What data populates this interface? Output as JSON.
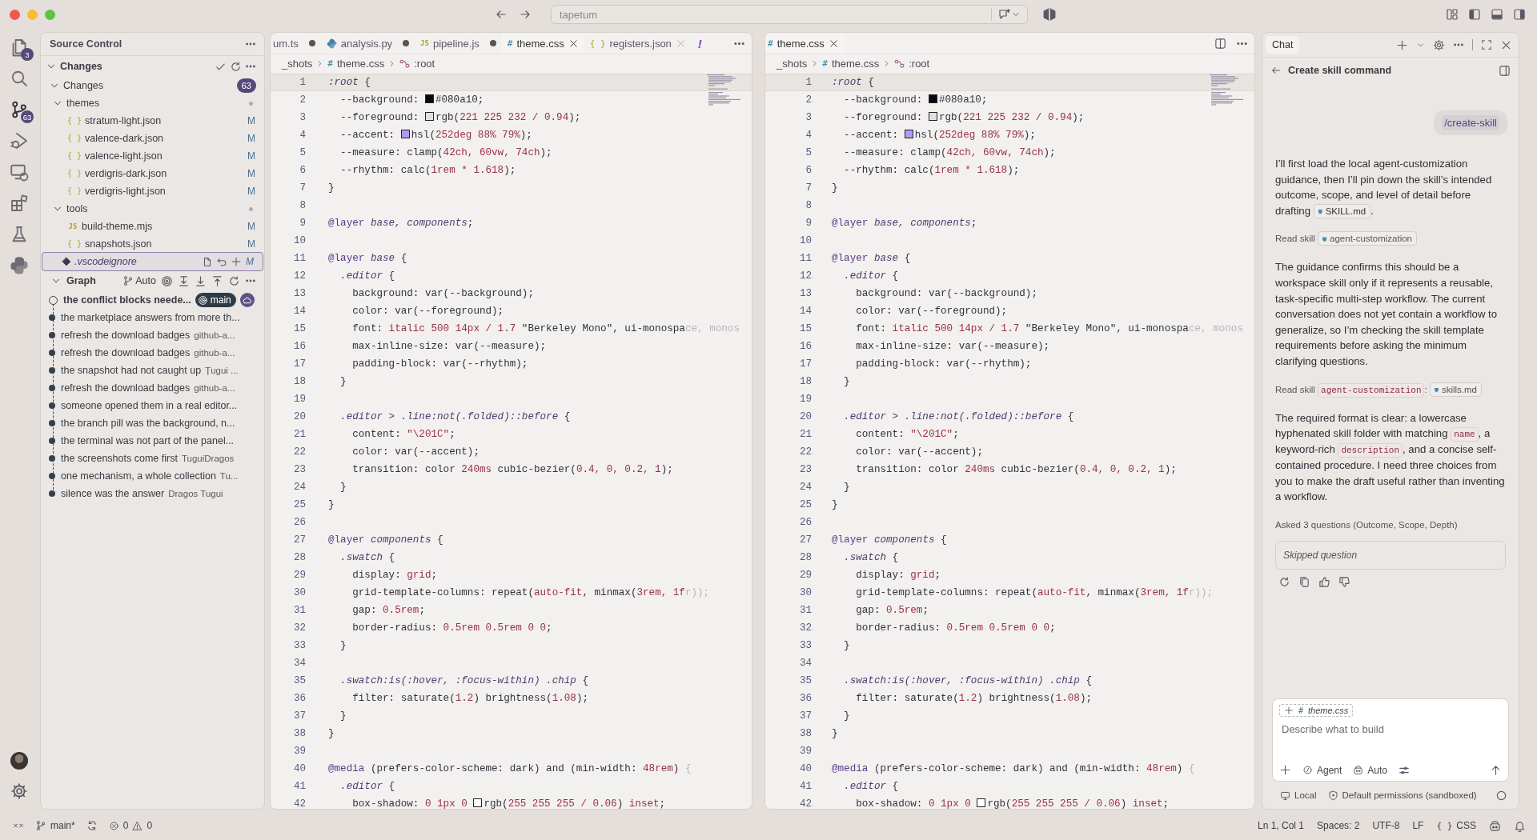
{
  "title_bar": {
    "title": "tapetum"
  },
  "activity_bar": {
    "items": [
      {
        "kind": "files",
        "badge": "3",
        "selected": false
      },
      {
        "kind": "search",
        "selected": false
      },
      {
        "kind": "scm",
        "badge": "63",
        "selected": true
      },
      {
        "kind": "debug",
        "selected": false
      },
      {
        "kind": "remote",
        "selected": false
      },
      {
        "kind": "extensions",
        "selected": false
      },
      {
        "kind": "testing",
        "selected": false
      },
      {
        "kind": "python",
        "selected": false
      }
    ],
    "bottom": [
      {
        "kind": "account"
      },
      {
        "kind": "settings"
      }
    ]
  },
  "sidebar": {
    "title": "Source Control",
    "changes": {
      "title": "Changes",
      "expanded": true,
      "group": {
        "label": "Changes",
        "count": "63",
        "expanded": true,
        "children": [
          {
            "kind": "folder",
            "label": "themes",
            "expanded": true,
            "selected": false,
            "children": [
              {
                "kind": "file",
                "icon": "{ }",
                "label": "stratum-light.json",
                "status": "M",
                "selected": false
              },
              {
                "kind": "file",
                "icon": "{ }",
                "label": "valence-dark.json",
                "status": "M",
                "selected": false
              },
              {
                "kind": "file",
                "icon": "{ }",
                "label": "valence-light.json",
                "status": "M",
                "selected": false
              },
              {
                "kind": "file",
                "icon": "{ }",
                "label": "verdigris-dark.json",
                "status": "M",
                "selected": false
              },
              {
                "kind": "file",
                "icon": "{ }",
                "label": "verdigris-light.json",
                "status": "M",
                "selected": false
              }
            ]
          },
          {
            "kind": "folder",
            "label": "tools",
            "expanded": true,
            "selected": false,
            "children": [
              {
                "kind": "file",
                "icon": "JS",
                "label": "build-theme.mjs",
                "status": "M",
                "selected": false
              },
              {
                "kind": "file",
                "icon": "{ }",
                "label": "snapshots.json",
                "status": "M",
                "selected": false
              }
            ]
          },
          {
            "kind": "ignore",
            "label": ".vscodeignore",
            "status": "M",
            "selected": true
          }
        ]
      }
    },
    "graph": {
      "title": "Graph",
      "filter": "Auto",
      "expanded": true,
      "commits": [
        {
          "message": "the conflict blocks neede...",
          "branch": "main",
          "head": true
        },
        {
          "message": "the marketplace answers from more th...",
          "head": false
        },
        {
          "message": "refresh the download badges",
          "author": "github-a...",
          "head": false
        },
        {
          "message": "refresh the download badges",
          "author": "github-a...",
          "head": false
        },
        {
          "message": "the snapshot had not caught up",
          "author": "Țugui ...",
          "head": false
        },
        {
          "message": "refresh the download badges",
          "author": "github-a...",
          "head": false
        },
        {
          "message": "someone opened them in a real editor...",
          "head": false
        },
        {
          "message": "the branch pill was the background, n...",
          "head": false
        },
        {
          "message": "the terminal was not part of the panel...",
          "head": false
        },
        {
          "message": "the screenshots come first",
          "author": "TuguiDragos",
          "head": false
        },
        {
          "message": "one mechanism, a whole collection",
          "author": "Tu...",
          "head": false
        },
        {
          "message": "silence was the answer",
          "author": "Dragos Tugui",
          "head": false
        }
      ]
    }
  },
  "editors": [
    {
      "tabs": [
        {
          "label": "um.ts",
          "kind": "none",
          "dirty": true,
          "selected": false
        },
        {
          "label": "analysis.py",
          "kind": "python",
          "dirty": true,
          "selected": false
        },
        {
          "label": "pipeline.js",
          "kind": "text",
          "icon": "JS",
          "dirty": true,
          "selected": false
        },
        {
          "label": "theme.css",
          "kind": "text",
          "icon": "#",
          "dirty": false,
          "selected": true
        },
        {
          "label": "registers.json",
          "kind": "text",
          "icon": "{ }",
          "dirty": false,
          "selected": false
        }
      ],
      "notice": "!",
      "breadcrumbs": [
        {
          "kind": "folder",
          "label": "_shots"
        },
        {
          "kind": "file",
          "icon": "#",
          "label": "theme.css"
        },
        {
          "kind": "symbol",
          "label": ":root"
        }
      ],
      "lines": [
        {
          "number": "1",
          "current": true,
          "tokens": [
            {
              "kind": "sel",
              "text": ":root"
            },
            {
              "kind": "plain",
              "text": " {"
            }
          ]
        },
        {
          "number": "2",
          "current": false,
          "tokens": [
            {
              "kind": "plain",
              "text": "  --background: "
            },
            {
              "kind": "swatch",
              "color": "#080a10"
            },
            {
              "kind": "plain",
              "text": "#080a10;"
            }
          ]
        },
        {
          "number": "3",
          "current": false,
          "tokens": [
            {
              "kind": "plain",
              "text": "  --foreground: "
            },
            {
              "kind": "swatch",
              "color": "#dde1e8"
            },
            {
              "kind": "plain",
              "text": "rgb("
            },
            {
              "kind": "num",
              "text": "221 225 232 / 0.94"
            },
            {
              "kind": "plain",
              "text": ");"
            }
          ]
        },
        {
          "number": "4",
          "current": false,
          "tokens": [
            {
              "kind": "plain",
              "text": "  --accent: "
            },
            {
              "kind": "swatch",
              "color": "#ad9af9"
            },
            {
              "kind": "plain",
              "text": "hsl("
            },
            {
              "kind": "num",
              "text": "252deg 88% 79%"
            },
            {
              "kind": "plain",
              "text": ");"
            }
          ]
        },
        {
          "number": "5",
          "current": false,
          "tokens": [
            {
              "kind": "plain",
              "text": "  --measure: clamp("
            },
            {
              "kind": "num",
              "text": "42ch, 60vw, 74ch"
            },
            {
              "kind": "plain",
              "text": ");"
            }
          ]
        },
        {
          "number": "6",
          "current": false,
          "tokens": [
            {
              "kind": "plain",
              "text": "  --rhythm: calc("
            },
            {
              "kind": "num",
              "text": "1rem * 1.618"
            },
            {
              "kind": "plain",
              "text": ");"
            }
          ]
        },
        {
          "number": "7",
          "current": false,
          "tokens": [
            {
              "kind": "plain",
              "text": "}"
            }
          ]
        },
        {
          "number": "8",
          "current": false
        },
        {
          "number": "9",
          "current": false,
          "tokens": [
            {
              "kind": "at",
              "text": "@layer"
            },
            {
              "kind": "sel",
              "text": " base, components"
            },
            {
              "kind": "plain",
              "text": ";"
            }
          ]
        },
        {
          "number": "10",
          "current": false
        },
        {
          "number": "11",
          "current": false,
          "tokens": [
            {
              "kind": "at",
              "text": "@layer"
            },
            {
              "kind": "sel",
              "text": " base"
            },
            {
              "kind": "plain",
              "text": " {"
            }
          ]
        },
        {
          "number": "12",
          "current": false,
          "tokens": [
            {
              "kind": "sel",
              "text": "  .editor"
            },
            {
              "kind": "plain",
              "text": " {"
            }
          ]
        },
        {
          "number": "13",
          "current": false,
          "tokens": [
            {
              "kind": "plain",
              "text": "    background: var(--background);"
            }
          ]
        },
        {
          "number": "14",
          "current": false,
          "tokens": [
            {
              "kind": "plain",
              "text": "    color: var(--foreground);"
            }
          ]
        },
        {
          "number": "15",
          "current": false,
          "tokens": [
            {
              "kind": "plain",
              "text": "    font: "
            },
            {
              "kind": "num",
              "text": "italic 500 14px / 1.7"
            },
            {
              "kind": "plain",
              "text": " \"Berkeley Mono\", ui-monospa"
            },
            {
              "kind": "fade",
              "text": "ce, monos"
            }
          ]
        },
        {
          "number": "16",
          "current": false,
          "tokens": [
            {
              "kind": "plain",
              "text": "    max-inline-size: var(--measure);"
            }
          ]
        },
        {
          "number": "17",
          "current": false,
          "tokens": [
            {
              "kind": "plain",
              "text": "    padding-block: var(--rhythm);"
            }
          ]
        },
        {
          "number": "18",
          "current": false,
          "tokens": [
            {
              "kind": "plain",
              "text": "  }"
            }
          ]
        },
        {
          "number": "19",
          "current": false
        },
        {
          "number": "20",
          "current": false,
          "tokens": [
            {
              "kind": "sel",
              "text": "  .editor > .line:not(.folded)::before"
            },
            {
              "kind": "plain",
              "text": " {"
            }
          ]
        },
        {
          "number": "21",
          "current": false,
          "tokens": [
            {
              "kind": "plain",
              "text": "    content: "
            },
            {
              "kind": "num",
              "text": "\"\\201C\""
            },
            {
              "kind": "plain",
              "text": ";"
            }
          ]
        },
        {
          "number": "22",
          "current": false,
          "tokens": [
            {
              "kind": "plain",
              "text": "    color: var(--accent);"
            }
          ]
        },
        {
          "number": "23",
          "current": false,
          "tokens": [
            {
              "kind": "plain",
              "text": "    transition: color "
            },
            {
              "kind": "num",
              "text": "240ms"
            },
            {
              "kind": "plain",
              "text": " cubic-bezier("
            },
            {
              "kind": "num",
              "text": "0.4, 0, 0.2, 1"
            },
            {
              "kind": "plain",
              "text": ");"
            }
          ]
        },
        {
          "number": "24",
          "current": false,
          "tokens": [
            {
              "kind": "plain",
              "text": "  }"
            }
          ]
        },
        {
          "number": "25",
          "current": false,
          "tokens": [
            {
              "kind": "plain",
              "text": "}"
            }
          ]
        },
        {
          "number": "26",
          "current": false
        },
        {
          "number": "27",
          "current": false,
          "tokens": [
            {
              "kind": "at",
              "text": "@layer"
            },
            {
              "kind": "sel",
              "text": " components"
            },
            {
              "kind": "plain",
              "text": " {"
            }
          ]
        },
        {
          "number": "28",
          "current": false,
          "tokens": [
            {
              "kind": "sel",
              "text": "  .swatch"
            },
            {
              "kind": "plain",
              "text": " {"
            }
          ]
        },
        {
          "number": "29",
          "current": false,
          "tokens": [
            {
              "kind": "plain",
              "text": "    display: "
            },
            {
              "kind": "num",
              "text": "grid"
            },
            {
              "kind": "plain",
              "text": ";"
            }
          ]
        },
        {
          "number": "30",
          "current": false,
          "tokens": [
            {
              "kind": "plain",
              "text": "    grid-template-columns: repeat("
            },
            {
              "kind": "num",
              "text": "auto-fit"
            },
            {
              "kind": "plain",
              "text": ", minmax("
            },
            {
              "kind": "num",
              "text": "3rem, 1f"
            },
            {
              "kind": "fade",
              "text": "r));"
            }
          ]
        },
        {
          "number": "31",
          "current": false,
          "tokens": [
            {
              "kind": "plain",
              "text": "    gap: "
            },
            {
              "kind": "num",
              "text": "0.5rem"
            },
            {
              "kind": "plain",
              "text": ";"
            }
          ]
        },
        {
          "number": "32",
          "current": false,
          "tokens": [
            {
              "kind": "plain",
              "text": "    border-radius: "
            },
            {
              "kind": "num",
              "text": "0.5rem 0.5rem 0 0"
            },
            {
              "kind": "plain",
              "text": ";"
            }
          ]
        },
        {
          "number": "33",
          "current": false,
          "tokens": [
            {
              "kind": "plain",
              "text": "  }"
            }
          ]
        },
        {
          "number": "34",
          "current": false
        },
        {
          "number": "35",
          "current": false,
          "tokens": [
            {
              "kind": "sel",
              "text": "  .swatch:is(:hover, :focus-within) .chip"
            },
            {
              "kind": "plain",
              "text": " {"
            }
          ]
        },
        {
          "number": "36",
          "current": false,
          "tokens": [
            {
              "kind": "plain",
              "text": "    filter: saturate("
            },
            {
              "kind": "num",
              "text": "1.2"
            },
            {
              "kind": "plain",
              "text": ") brightness("
            },
            {
              "kind": "num",
              "text": "1.08"
            },
            {
              "kind": "plain",
              "text": ");"
            }
          ]
        },
        {
          "number": "37",
          "current": false,
          "tokens": [
            {
              "kind": "plain",
              "text": "  }"
            }
          ]
        },
        {
          "number": "38",
          "current": false,
          "tokens": [
            {
              "kind": "plain",
              "text": "}"
            }
          ]
        },
        {
          "number": "39",
          "current": false
        },
        {
          "number": "40",
          "current": false,
          "tokens": [
            {
              "kind": "at",
              "text": "@media"
            },
            {
              "kind": "plain",
              "text": " (prefers-color-scheme: dark) and (min-width: "
            },
            {
              "kind": "num",
              "text": "48rem"
            },
            {
              "kind": "plain",
              "text": ") "
            },
            {
              "kind": "fade",
              "text": "{"
            }
          ]
        },
        {
          "number": "41",
          "current": false,
          "tokens": [
            {
              "kind": "sel",
              "text": "  .editor"
            },
            {
              "kind": "plain",
              "text": " {"
            }
          ]
        },
        {
          "number": "42",
          "current": false,
          "tokens": [
            {
              "kind": "plain",
              "text": "    box-shadow: "
            },
            {
              "kind": "num",
              "text": "0 1px 0 "
            },
            {
              "kind": "swatch",
              "color": "#ffffff"
            },
            {
              "kind": "plain",
              "text": "rgb("
            },
            {
              "kind": "num",
              "text": "255 255 255 / 0.06"
            },
            {
              "kind": "plain",
              "text": ") "
            },
            {
              "kind": "num",
              "text": "inset"
            },
            {
              "kind": "plain",
              "text": ";"
            }
          ]
        }
      ]
    },
    {
      "tabs": [
        {
          "label": "theme.css",
          "kind": "text",
          "icon": "#",
          "dirty": false,
          "selected": true
        }
      ],
      "breadcrumbs": [
        {
          "kind": "folder",
          "label": "_shots"
        },
        {
          "kind": "file",
          "icon": "#",
          "label": "theme.css"
        },
        {
          "kind": "symbol",
          "label": ":root"
        }
      ],
      "lines": [
        {
          "number": "1",
          "current": true,
          "tokens": [
            {
              "kind": "sel",
              "text": ":root"
            },
            {
              "kind": "plain",
              "text": " {"
            }
          ]
        },
        {
          "number": "2",
          "current": false,
          "tokens": [
            {
              "kind": "plain",
              "text": "  --background: "
            },
            {
              "kind": "swatch",
              "color": "#080a10"
            },
            {
              "kind": "plain",
              "text": "#080a10;"
            }
          ]
        },
        {
          "number": "3",
          "current": false,
          "tokens": [
            {
              "kind": "plain",
              "text": "  --foreground: "
            },
            {
              "kind": "swatch",
              "color": "#dde1e8"
            },
            {
              "kind": "plain",
              "text": "rgb("
            },
            {
              "kind": "num",
              "text": "221 225 232 / 0.94"
            },
            {
              "kind": "plain",
              "text": ");"
            }
          ]
        },
        {
          "number": "4",
          "current": false,
          "tokens": [
            {
              "kind": "plain",
              "text": "  --accent: "
            },
            {
              "kind": "swatch",
              "color": "#ad9af9"
            },
            {
              "kind": "plain",
              "text": "hsl("
            },
            {
              "kind": "num",
              "text": "252deg 88% 79%"
            },
            {
              "kind": "plain",
              "text": ");"
            }
          ]
        },
        {
          "number": "5",
          "current": false,
          "tokens": [
            {
              "kind": "plain",
              "text": "  --measure: clamp("
            },
            {
              "kind": "num",
              "text": "42ch, 60vw, 74ch"
            },
            {
              "kind": "plain",
              "text": ");"
            }
          ]
        },
        {
          "number": "6",
          "current": false,
          "tokens": [
            {
              "kind": "plain",
              "text": "  --rhythm: calc("
            },
            {
              "kind": "num",
              "text": "1rem * 1.618"
            },
            {
              "kind": "plain",
              "text": ");"
            }
          ]
        },
        {
          "number": "7",
          "current": false,
          "tokens": [
            {
              "kind": "plain",
              "text": "}"
            }
          ]
        },
        {
          "number": "8",
          "current": false
        },
        {
          "number": "9",
          "current": false,
          "tokens": [
            {
              "kind": "at",
              "text": "@layer"
            },
            {
              "kind": "sel",
              "text": " base, components"
            },
            {
              "kind": "plain",
              "text": ";"
            }
          ]
        },
        {
          "number": "10",
          "current": false
        },
        {
          "number": "11",
          "current": false,
          "tokens": [
            {
              "kind": "at",
              "text": "@layer"
            },
            {
              "kind": "sel",
              "text": " base"
            },
            {
              "kind": "plain",
              "text": " {"
            }
          ]
        },
        {
          "number": "12",
          "current": false,
          "tokens": [
            {
              "kind": "sel",
              "text": "  .editor"
            },
            {
              "kind": "plain",
              "text": " {"
            }
          ]
        },
        {
          "number": "13",
          "current": false,
          "tokens": [
            {
              "kind": "plain",
              "text": "    background: var(--background);"
            }
          ]
        },
        {
          "number": "14",
          "current": false,
          "tokens": [
            {
              "kind": "plain",
              "text": "    color: var(--foreground);"
            }
          ]
        },
        {
          "number": "15",
          "current": false,
          "tokens": [
            {
              "kind": "plain",
              "text": "    font: "
            },
            {
              "kind": "num",
              "text": "italic 500 14px / 1.7"
            },
            {
              "kind": "plain",
              "text": " \"Berkeley Mono\", ui-monospa"
            },
            {
              "kind": "fade",
              "text": "ce, monos"
            }
          ]
        },
        {
          "number": "16",
          "current": false,
          "tokens": [
            {
              "kind": "plain",
              "text": "    max-inline-size: var(--measure);"
            }
          ]
        },
        {
          "number": "17",
          "current": false,
          "tokens": [
            {
              "kind": "plain",
              "text": "    padding-block: var(--rhythm);"
            }
          ]
        },
        {
          "number": "18",
          "current": false,
          "tokens": [
            {
              "kind": "plain",
              "text": "  }"
            }
          ]
        },
        {
          "number": "19",
          "current": false
        },
        {
          "number": "20",
          "current": false,
          "tokens": [
            {
              "kind": "sel",
              "text": "  .editor > .line:not(.folded)::before"
            },
            {
              "kind": "plain",
              "text": " {"
            }
          ]
        },
        {
          "number": "21",
          "current": false,
          "tokens": [
            {
              "kind": "plain",
              "text": "    content: "
            },
            {
              "kind": "num",
              "text": "\"\\201C\""
            },
            {
              "kind": "plain",
              "text": ";"
            }
          ]
        },
        {
          "number": "22",
          "current": false,
          "tokens": [
            {
              "kind": "plain",
              "text": "    color: var(--accent);"
            }
          ]
        },
        {
          "number": "23",
          "current": false,
          "tokens": [
            {
              "kind": "plain",
              "text": "    transition: color "
            },
            {
              "kind": "num",
              "text": "240ms"
            },
            {
              "kind": "plain",
              "text": " cubic-bezier("
            },
            {
              "kind": "num",
              "text": "0.4, 0, 0.2, 1"
            },
            {
              "kind": "plain",
              "text": ");"
            }
          ]
        },
        {
          "number": "24",
          "current": false,
          "tokens": [
            {
              "kind": "plain",
              "text": "  }"
            }
          ]
        },
        {
          "number": "25",
          "current": false,
          "tokens": [
            {
              "kind": "plain",
              "text": "}"
            }
          ]
        },
        {
          "number": "26",
          "current": false
        },
        {
          "number": "27",
          "current": false,
          "tokens": [
            {
              "kind": "at",
              "text": "@layer"
            },
            {
              "kind": "sel",
              "text": " components"
            },
            {
              "kind": "plain",
              "text": " {"
            }
          ]
        },
        {
          "number": "28",
          "current": false,
          "tokens": [
            {
              "kind": "sel",
              "text": "  .swatch"
            },
            {
              "kind": "plain",
              "text": " {"
            }
          ]
        },
        {
          "number": "29",
          "current": false,
          "tokens": [
            {
              "kind": "plain",
              "text": "    display: "
            },
            {
              "kind": "num",
              "text": "grid"
            },
            {
              "kind": "plain",
              "text": ";"
            }
          ]
        },
        {
          "number": "30",
          "current": false,
          "tokens": [
            {
              "kind": "plain",
              "text": "    grid-template-columns: repeat("
            },
            {
              "kind": "num",
              "text": "auto-fit"
            },
            {
              "kind": "plain",
              "text": ", minmax("
            },
            {
              "kind": "num",
              "text": "3rem, 1f"
            },
            {
              "kind": "fade",
              "text": "r));"
            }
          ]
        },
        {
          "number": "31",
          "current": false,
          "tokens": [
            {
              "kind": "plain",
              "text": "    gap: "
            },
            {
              "kind": "num",
              "text": "0.5rem"
            },
            {
              "kind": "plain",
              "text": ";"
            }
          ]
        },
        {
          "number": "32",
          "current": false,
          "tokens": [
            {
              "kind": "plain",
              "text": "    border-radius: "
            },
            {
              "kind": "num",
              "text": "0.5rem 0.5rem 0 0"
            },
            {
              "kind": "plain",
              "text": ";"
            }
          ]
        },
        {
          "number": "33",
          "current": false,
          "tokens": [
            {
              "kind": "plain",
              "text": "  }"
            }
          ]
        },
        {
          "number": "34",
          "current": false
        },
        {
          "number": "35",
          "current": false,
          "tokens": [
            {
              "kind": "sel",
              "text": "  .swatch:is(:hover, :focus-within) .chip"
            },
            {
              "kind": "plain",
              "text": " {"
            }
          ]
        },
        {
          "number": "36",
          "current": false,
          "tokens": [
            {
              "kind": "plain",
              "text": "    filter: saturate("
            },
            {
              "kind": "num",
              "text": "1.2"
            },
            {
              "kind": "plain",
              "text": ") brightness("
            },
            {
              "kind": "num",
              "text": "1.08"
            },
            {
              "kind": "plain",
              "text": ");"
            }
          ]
        },
        {
          "number": "37",
          "current": false,
          "tokens": [
            {
              "kind": "plain",
              "text": "  }"
            }
          ]
        },
        {
          "number": "38",
          "current": false,
          "tokens": [
            {
              "kind": "plain",
              "text": "}"
            }
          ]
        },
        {
          "number": "39",
          "current": false
        },
        {
          "number": "40",
          "current": false,
          "tokens": [
            {
              "kind": "at",
              "text": "@media"
            },
            {
              "kind": "plain",
              "text": " (prefers-color-scheme: dark) and (min-width: "
            },
            {
              "kind": "num",
              "text": "48rem"
            },
            {
              "kind": "plain",
              "text": ") "
            },
            {
              "kind": "fade",
              "text": "{"
            }
          ]
        },
        {
          "number": "41",
          "current": false,
          "tokens": [
            {
              "kind": "sel",
              "text": "  .editor"
            },
            {
              "kind": "plain",
              "text": " {"
            }
          ]
        },
        {
          "number": "42",
          "current": false,
          "tokens": [
            {
              "kind": "plain",
              "text": "    box-shadow: "
            },
            {
              "kind": "num",
              "text": "0 1px 0 "
            },
            {
              "kind": "swatch",
              "color": "#ffffff"
            },
            {
              "kind": "plain",
              "text": "rgb("
            },
            {
              "kind": "num",
              "text": "255 255 255 / 0.06"
            },
            {
              "kind": "plain",
              "text": ") "
            },
            {
              "kind": "num",
              "text": "inset"
            },
            {
              "kind": "plain",
              "text": ";"
            }
          ]
        }
      ]
    }
  ],
  "chat": {
    "tab": "Chat",
    "title": "Create skill command",
    "user_message": "/create-skill",
    "messages": [
      {
        "kind": "paragraph",
        "parts": [
          {
            "kind": "text",
            "text": "I’ll first load the local agent-customization guidance, then I’ll pin down the skill’s intended outcome, scope, and level of detail before drafting "
          },
          {
            "kind": "file",
            "text": "SKILL.md"
          },
          {
            "kind": "text",
            "text": "."
          }
        ]
      },
      {
        "kind": "tool",
        "parts": [
          {
            "kind": "text",
            "text": "Read skill "
          },
          {
            "kind": "file",
            "text": "agent-customization"
          }
        ]
      },
      {
        "kind": "paragraph",
        "parts": [
          {
            "kind": "text",
            "text": "The guidance confirms this should be a workspace skill only if it represents a reusable, task-specific multi-step workflow. The current conversation does not yet contain a workflow to generalize, so I’m checking the skill template requirements before asking the minimum clarifying questions."
          }
        ]
      },
      {
        "kind": "tool",
        "parts": [
          {
            "kind": "text",
            "text": "Read skill "
          },
          {
            "kind": "code",
            "text": "agent-customization"
          },
          {
            "kind": "text",
            "text": ": "
          },
          {
            "kind": "file",
            "text": "skills.md"
          }
        ]
      },
      {
        "kind": "paragraph",
        "parts": [
          {
            "kind": "text",
            "text": "The required format is clear: a lowercase hyphenated skill folder with matching "
          },
          {
            "kind": "code",
            "text": "name"
          },
          {
            "kind": "text",
            "text": ", a keyword-rich "
          },
          {
            "kind": "code",
            "text": "description"
          },
          {
            "kind": "text",
            "text": ", and a concise self-contained procedure. I need three choices from you to make the draft useful rather than inventing a workflow."
          }
        ]
      },
      {
        "kind": "tool",
        "parts": [
          {
            "kind": "text",
            "text": "Asked 3 questions (Outcome, Scope, Depth)"
          }
        ]
      }
    ],
    "question_box": "Skipped question",
    "input": {
      "attachment_icon": "#",
      "attachment": "theme.css",
      "placeholder": "Describe what to build",
      "mode": "Agent",
      "model": "Auto"
    },
    "footer": {
      "location": "Local",
      "permissions": "Default permissions (sandboxed)"
    }
  },
  "status_bar": {
    "branch": "main*",
    "errors": "0",
    "warnings": "0",
    "position": "Ln 1, Col 1",
    "indent": "Spaces: 2",
    "encoding": "UTF-8",
    "eol": "LF",
    "language_icon": "{ }",
    "language": "CSS"
  }
}
